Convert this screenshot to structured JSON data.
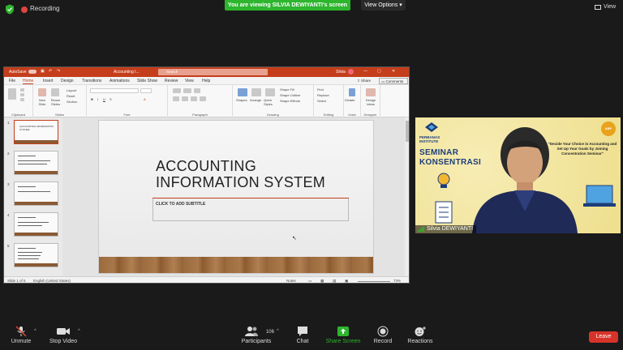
{
  "topbar": {
    "recording_label": "Recording",
    "viewing_banner": "You are viewing SILVIA DEWIYANTI's screen",
    "view_options_label": "View Options",
    "view_label": "View"
  },
  "ppt": {
    "autosave_label": "AutoSave",
    "doc_title": "Accounting I...",
    "search_placeholder": "Search",
    "user_name": "Silvia",
    "tabs": [
      "File",
      "Home",
      "Insert",
      "Design",
      "Transitions",
      "Animations",
      "Slide Show",
      "Review",
      "View",
      "Help"
    ],
    "active_tab": "Home",
    "share_label": "Share",
    "comments_label": "Comments",
    "ribbon": {
      "clipboard": "Clipboard",
      "slides": "Slides",
      "font": "Font",
      "paragraph": "Paragraph",
      "drawing": "Drawing",
      "editing": "Editing",
      "voice": "Voice",
      "designer": "Designer",
      "new_slide": "New Slide",
      "reuse_slides": "Reuse Slides",
      "layout": "Layout",
      "reset": "Reset",
      "section": "Section",
      "shapes": "Shapes",
      "arrange": "Arrange",
      "quick_styles": "Quick Styles",
      "shape_fill": "Shape Fill",
      "shape_outline": "Shape Outline",
      "shape_effects": "Shape Effects",
      "find": "Find",
      "replace": "Replace",
      "select": "Select",
      "dictate": "Dictate",
      "design_ideas": "Design Ideas"
    },
    "slide": {
      "title_line1": "ACCOUNTING",
      "title_line2": "INFORMATION SYSTEM",
      "subtitle_placeholder": "CLICK TO ADD SUBTITLE"
    },
    "thumbnails": [
      {
        "num": "1",
        "title": "ACCOUNTING INFORMATION SYSTEM"
      },
      {
        "num": "2"
      },
      {
        "num": "3"
      },
      {
        "num": "4"
      },
      {
        "num": "5"
      }
    ],
    "status": {
      "slide_count": "Slide 1 of 5",
      "language": "English (United States)",
      "notes": "Notes",
      "zoom": "73%"
    }
  },
  "cam": {
    "institute_line1": "PERBANAS",
    "institute_line2": "INSTITUTE",
    "seminar_line1": "SEMINAR",
    "seminar_line2": "KONSENTRASI",
    "quote": "\"Decide Your Choice in Accounting and Set Up Your Goals by Joining Concentration Seminar\"",
    "badge": "ABP",
    "participant_name": "Silvia DEWIYANTI"
  },
  "toolbar": {
    "unmute": "Unmute",
    "stop_video": "Stop Video",
    "participants": "Participants",
    "participants_count": "106",
    "chat": "Chat",
    "share_screen": "Share Screen",
    "record": "Record",
    "reactions": "Reactions",
    "leave": "Leave"
  }
}
